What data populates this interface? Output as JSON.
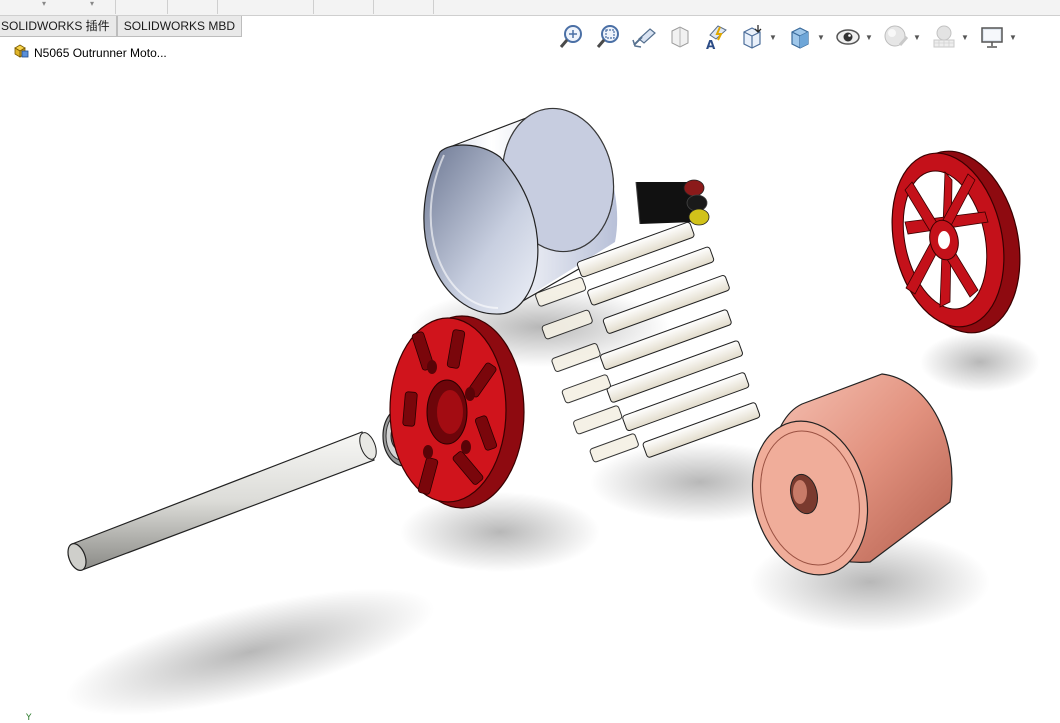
{
  "tabs": [
    {
      "label": "SOLIDWORKS 插件"
    },
    {
      "label": "SOLIDWORKS MBD"
    }
  ],
  "feature_tree": {
    "root_label": "N5065 Outrunner Moto..."
  },
  "view_toolbar": {
    "items": [
      {
        "icon": "zoom-to-fit-icon"
      },
      {
        "icon": "zoom-to-area-icon"
      },
      {
        "icon": "previous-view-icon"
      },
      {
        "icon": "section-view-icon"
      },
      {
        "icon": "dynamic-annotation-views-icon"
      },
      {
        "icon": "view-orientation-icon"
      },
      {
        "icon": "display-style-icon"
      },
      {
        "icon": "hide-show-items-icon"
      },
      {
        "icon": "edit-appearance-icon"
      },
      {
        "icon": "apply-scene-icon"
      },
      {
        "icon": "view-settings-icon"
      }
    ]
  },
  "triad": {
    "y_label": "Y"
  },
  "colors": {
    "red_part": "#c8101a",
    "can": "#e6eaf5",
    "copper": "#e29a86",
    "shaft": "#dedede"
  }
}
